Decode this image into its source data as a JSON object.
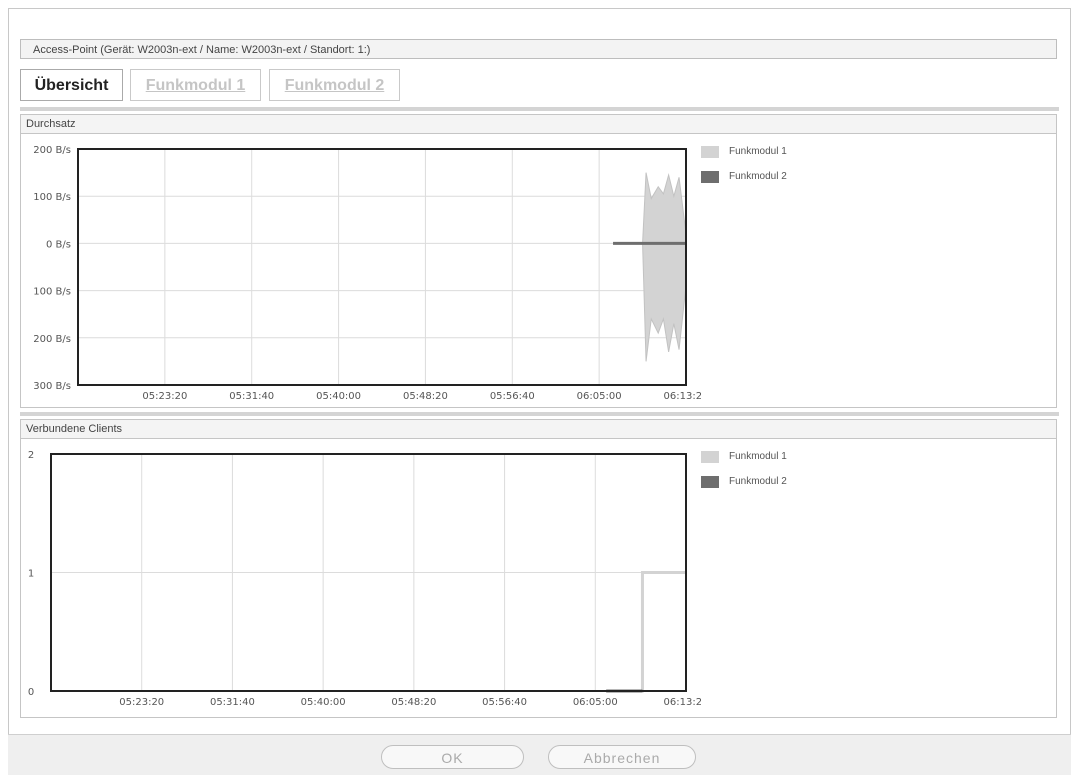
{
  "window": {
    "title": "Access-Point (Gerät: W2003n-ext / Name: W2003n-ext / Standort: 1:)"
  },
  "tabs": [
    {
      "label": "Übersicht",
      "active": true
    },
    {
      "label": "Funkmodul 1",
      "active": false
    },
    {
      "label": "Funkmodul 2",
      "active": false
    }
  ],
  "panels": {
    "throughput": {
      "title": "Durchsatz"
    },
    "clients": {
      "title": "Verbundene Clients"
    }
  },
  "legend": {
    "items": [
      {
        "label": "Funkmodul 1",
        "color": "#d3d3d3"
      },
      {
        "label": "Funkmodul 2",
        "color": "#6e6e6e"
      }
    ]
  },
  "buttons": {
    "ok": "OK",
    "cancel": "Abbrechen"
  },
  "chart_data": [
    {
      "type": "area",
      "title": "Durchsatz",
      "ytick_labels": [
        "200 B/s",
        "100 B/s",
        "0 B/s",
        "100 B/s",
        "200 B/s",
        "300 B/s"
      ],
      "ytick_values": [
        200,
        100,
        0,
        -100,
        -200,
        -300
      ],
      "ylim": [
        -300,
        200
      ],
      "xtick_labels": [
        "05:23:20",
        "05:31:40",
        "05:40:00",
        "05:48:20",
        "05:56:40",
        "06:05:00",
        "06:13:20"
      ],
      "xlim": [
        "05:15:00",
        "06:13:20"
      ],
      "grid": true,
      "legend_position": "right",
      "series": [
        {
          "name": "Funkmodul 1",
          "color": "#d3d3d3",
          "x": [
            "06:09:10",
            "06:09:30",
            "06:10:00",
            "06:10:40",
            "06:11:10",
            "06:11:40",
            "06:12:10",
            "06:12:40",
            "06:13:20"
          ],
          "upper": [
            0,
            150,
            95,
            120,
            105,
            145,
            100,
            140,
            20
          ],
          "lower": [
            0,
            -250,
            -160,
            -190,
            -160,
            -230,
            -170,
            -225,
            -90
          ]
        },
        {
          "name": "Funkmodul 2",
          "color": "#6e6e6e",
          "x": [
            "06:06:20",
            "06:13:20"
          ],
          "values": [
            0,
            0
          ]
        }
      ]
    },
    {
      "type": "line",
      "title": "Verbundene Clients",
      "ytick_labels": [
        "2",
        "1",
        "0"
      ],
      "ytick_values": [
        2,
        1,
        0
      ],
      "ylim": [
        0,
        2
      ],
      "xtick_labels": [
        "05:23:20",
        "05:31:40",
        "05:40:00",
        "05:48:20",
        "05:56:40",
        "06:05:00",
        "06:13:20"
      ],
      "xlim": [
        "05:15:00",
        "06:13:20"
      ],
      "grid": true,
      "legend_position": "right",
      "series": [
        {
          "name": "Funkmodul 1",
          "color": "#d3d3d3",
          "x": [
            "06:08:40",
            "06:09:20",
            "06:09:20",
            "06:13:20"
          ],
          "values": [
            0,
            0,
            1,
            1
          ]
        },
        {
          "name": "Funkmodul 2",
          "color": "#6e6e6e",
          "x": [
            "06:06:00",
            "06:09:20"
          ],
          "values": [
            0,
            0
          ]
        }
      ]
    }
  ]
}
